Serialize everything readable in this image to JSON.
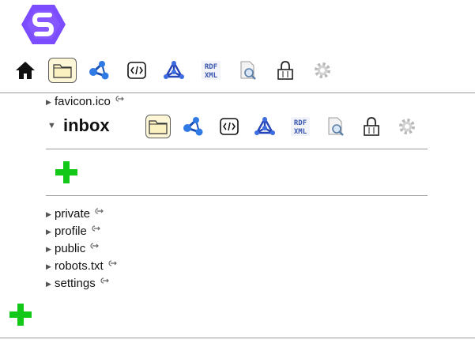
{
  "icons": {
    "logo": "solid-logo-icon",
    "home": "home-icon",
    "folder": "folder-icon",
    "share": "share-network-icon",
    "code": "code-icon",
    "graph": "graph-molecule-icon",
    "rdf": "rdf-xml-icon",
    "search": "document-search-icon",
    "lock": "lock-icon",
    "settings": "gear-icon",
    "external": "external-link-icon",
    "add": "plus-icon"
  },
  "colors": {
    "brand": "#7c4dff",
    "add": "#14c81a",
    "link_blue": "#1a5fd6"
  },
  "rdf_label_top": "RDF",
  "rdf_label_bottom": "XML",
  "tree": {
    "favicon": "favicon.ico",
    "inbox": "inbox",
    "children": [
      "private",
      "profile",
      "public",
      "robots.txt",
      "settings"
    ]
  }
}
